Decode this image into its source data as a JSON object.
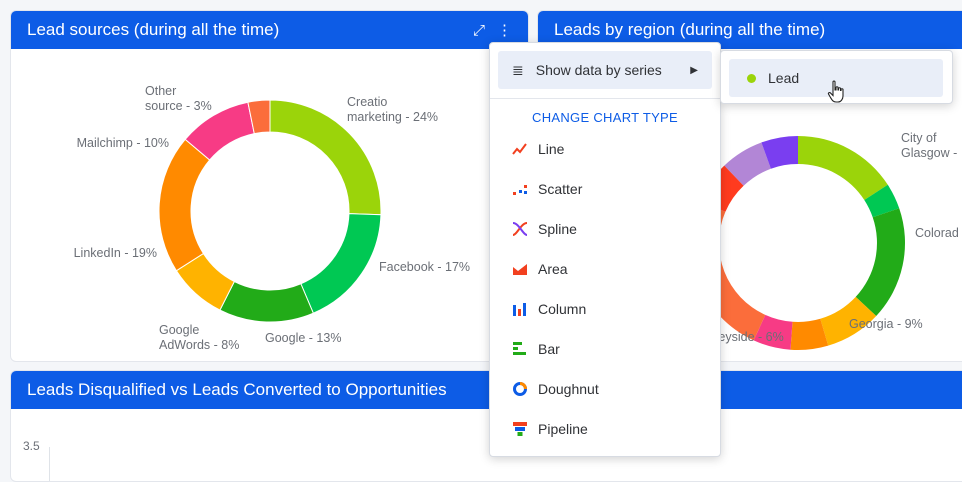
{
  "widgets": {
    "lead_sources": {
      "title": "Lead sources (during all the time)"
    },
    "leads_by_region": {
      "title": "Leads by region (during all the time)"
    },
    "disqualified": {
      "title": "Leads Disqualified vs Leads Converted to Opportunities",
      "y_tick": "3.5"
    }
  },
  "menu": {
    "show_series": "Show data by series",
    "change_type_heading": "CHANGE CHART TYPE",
    "items": [
      {
        "label": "Line",
        "icon": "line-chart-icon"
      },
      {
        "label": "Scatter",
        "icon": "scatter-chart-icon"
      },
      {
        "label": "Spline",
        "icon": "spline-chart-icon"
      },
      {
        "label": "Area",
        "icon": "area-chart-icon"
      },
      {
        "label": "Column",
        "icon": "column-chart-icon"
      },
      {
        "label": "Bar",
        "icon": "bar-chart-icon"
      },
      {
        "label": "Doughnut",
        "icon": "doughnut-chart-icon"
      },
      {
        "label": "Pipeline",
        "icon": "pipeline-chart-icon"
      }
    ]
  },
  "submenu": {
    "series": [
      {
        "label": "Lead",
        "color": "#9bd40a"
      }
    ]
  },
  "chart_data": [
    {
      "type": "pie",
      "title": "Lead sources (during all the time)",
      "categories": [
        "Creatio marketing",
        "Facebook",
        "Google",
        "Google AdWords",
        "LinkedIn",
        "Mailchimp",
        "Other source"
      ],
      "values": [
        24,
        17,
        13,
        8,
        19,
        10,
        3
      ],
      "colors": [
        "#9bd40a",
        "#00c853",
        "#22ab18",
        "#ffb300",
        "#ff8a00",
        "#f73b85",
        "#fb6d3b"
      ],
      "labels": [
        [
          "Creatio",
          "marketing - 24%"
        ],
        [
          "Facebook - 17%"
        ],
        [
          "Google - 13%"
        ],
        [
          "Google",
          "AdWords - 8%"
        ],
        [
          "LinkedIn - 19%"
        ],
        [
          "Mailchimp - 10%"
        ],
        [
          "Other",
          "source - 3%"
        ]
      ]
    },
    {
      "type": "pie",
      "title": "Leads by region (during all the time)",
      "visible_labels": [
        [
          "City of",
          "Glasgow -"
        ],
        [
          "Colorad"
        ],
        [
          "Georgia - 9%"
        ],
        [
          "rseyside - 6%"
        ]
      ]
    }
  ]
}
